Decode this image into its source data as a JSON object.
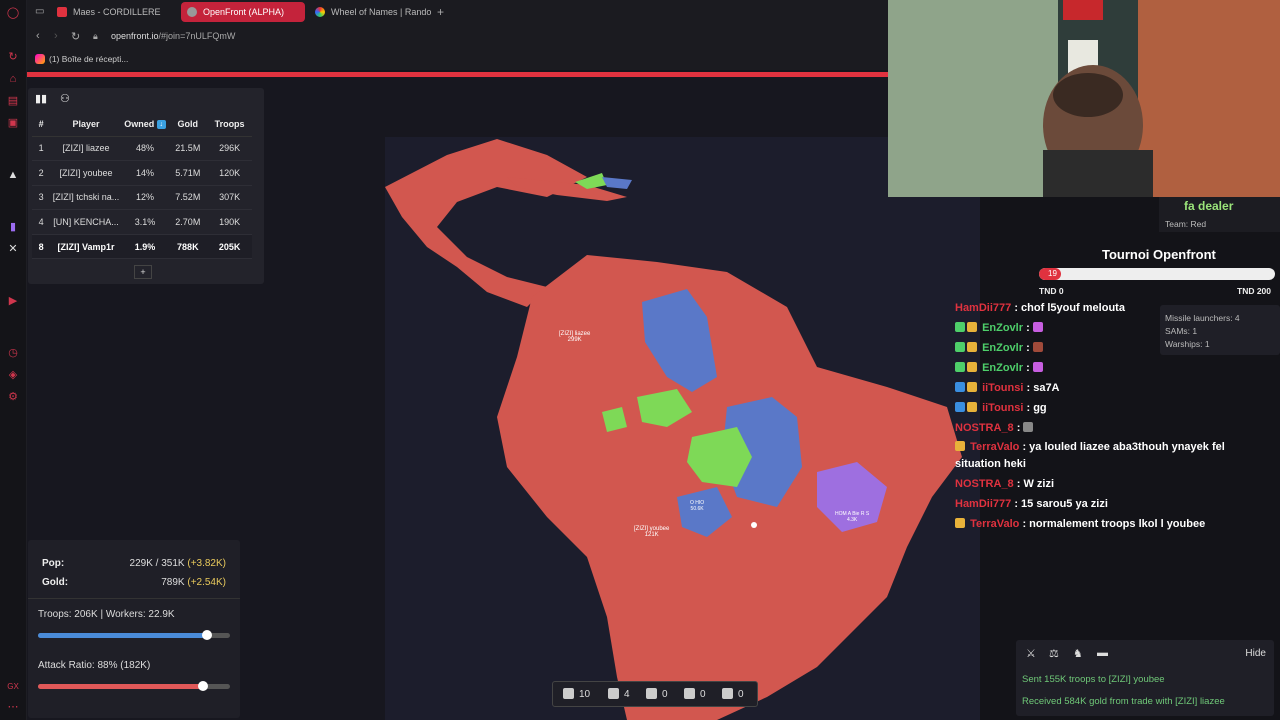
{
  "browser": {
    "tabs": [
      {
        "label": "Maes - CORDILLERE ",
        "active": false
      },
      {
        "label": "OpenFront (ALPHA)",
        "active": true
      },
      {
        "label": "Wheel of Names | Random",
        "active": false
      }
    ],
    "url_host": "openfront.io",
    "url_path": "/#join=7nULFQmW",
    "bookmark": "(1) Boîte de récepti..."
  },
  "leaderboard": {
    "headers": [
      "#",
      "Player",
      "Owned",
      "Gold",
      "Troops"
    ],
    "rows": [
      {
        "rank": "1",
        "player": "[ZIZI] liazee",
        "owned": "48%",
        "gold": "21.5M",
        "troops": "296K"
      },
      {
        "rank": "2",
        "player": "[ZIZI] youbee",
        "owned": "14%",
        "gold": "5.71M",
        "troops": "120K"
      },
      {
        "rank": "3",
        "player": "[ZIZI] tchski na...",
        "owned": "12%",
        "gold": "7.52M",
        "troops": "307K"
      },
      {
        "rank": "4",
        "player": "[UN] KENCHA...",
        "owned": "3.1%",
        "gold": "2.70M",
        "troops": "190K"
      },
      {
        "rank": "8",
        "player": "[ZIZI] Vamp1r",
        "owned": "1.9%",
        "gold": "788K",
        "troops": "205K"
      }
    ],
    "add_label": "+"
  },
  "map_labels": [
    {
      "name": "[ZIZI] liazee",
      "troops": "299K"
    },
    {
      "name": "[ZIZI] youbee",
      "troops": "121K"
    },
    {
      "name": "O HIO",
      "troops": "50.6K"
    },
    {
      "name": "HOM A Bie R S",
      "troops": "4.3K"
    }
  ],
  "stats": {
    "pop_label": "Pop:",
    "pop_value": "229K / 351K",
    "pop_delta": "(+3.82K)",
    "gold_label": "Gold:",
    "gold_value": "789K",
    "gold_delta": "(+2.54K)",
    "troops_workers": "Troops: 206K | Workers: 22.9K",
    "troops_slider": 0.88,
    "attack_ratio": "Attack Ratio: 88% (182K)",
    "attack_slider": 0.86
  },
  "buildbar": [
    {
      "icon": "city-icon",
      "count": "10"
    },
    {
      "icon": "port-icon",
      "count": "4"
    },
    {
      "icon": "defense-post-icon",
      "count": "0"
    },
    {
      "icon": "missile-silo-icon",
      "count": "0"
    },
    {
      "icon": "sam-launcher-icon",
      "count": "0"
    }
  ],
  "overlay": {
    "dealer_name": "fa dealer",
    "team": "Team: Red",
    "tournament_title": "Tournoi Openfront",
    "progress_value": "19",
    "progress_fraction": 0.095,
    "progress_min": "TND 0",
    "progress_max": "TND 200",
    "info_lines": [
      "Missile launchers: 4",
      "SAMs: 1",
      "Warships: 1"
    ]
  },
  "chat": [
    {
      "user": "HamDii777",
      "color": "#e0323f",
      "text": ": chof l5youf melouta"
    },
    {
      "user": "EnZovlr",
      "color": "#4ecf6a",
      "text": ":"
    },
    {
      "user": "EnZovlr",
      "color": "#4ecf6a",
      "text": ":"
    },
    {
      "user": "EnZovlr",
      "color": "#4ecf6a",
      "text": ":"
    },
    {
      "user": "iiTounsi",
      "color": "#e0323f",
      "text": ": sa7A"
    },
    {
      "user": "iiTounsi",
      "color": "#e0323f",
      "text": ": gg"
    },
    {
      "user": "NOSTRA_8",
      "color": "#e0323f",
      "text": ":"
    },
    {
      "user": "TerraValo",
      "color": "#e0323f",
      "text": ": ya louled liazee aba3thouh ynayek fel situation heki"
    },
    {
      "user": "NOSTRA_8",
      "color": "#e0323f",
      "text": ": W zizi"
    },
    {
      "user": "HamDii777",
      "color": "#e0323f",
      "text": ": 15 sarou5 ya zizi"
    },
    {
      "user": "TerraValo",
      "color": "#e0323f",
      "text": ": normalement troops lkol l youbee"
    }
  ],
  "events": {
    "hide_label": "Hide",
    "lines": [
      "Sent 155K troops to [ZIZI] youbee",
      "Received 584K gold from trade with [ZIZI] liazee"
    ]
  }
}
